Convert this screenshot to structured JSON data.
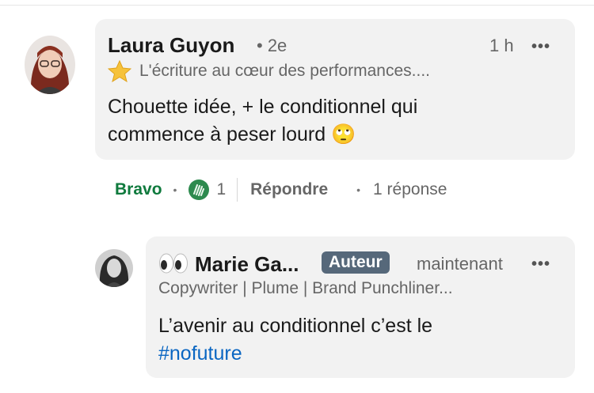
{
  "comment": {
    "author": "Laura Guyon",
    "degree": "• 2e",
    "time": "1 h",
    "more": "•••",
    "headline": "L'écriture au cœur des performances....",
    "text_line1": "Chouette idée, + le conditionnel qui",
    "text_line2": "commence à peser lourd",
    "emoji": "🙄"
  },
  "actions": {
    "react_label": "Bravo",
    "reaction_count": "1",
    "reply_label": "Répondre",
    "replies": "1 réponse",
    "bullet": "•"
  },
  "reply": {
    "author": "Marie Ga...",
    "author_badge": "Auteur",
    "time": "maintenant",
    "more": "•••",
    "headline": "Copywriter | Plume | Brand Punchliner...",
    "text_line1": "L’avenir au conditionnel c’est le",
    "hashtag": "#nofuture"
  },
  "colors": {
    "bubble": "#f2f2f2",
    "bravo": "#0f7a3d",
    "badge": "#56687a",
    "hashtag": "#0a66c2"
  }
}
